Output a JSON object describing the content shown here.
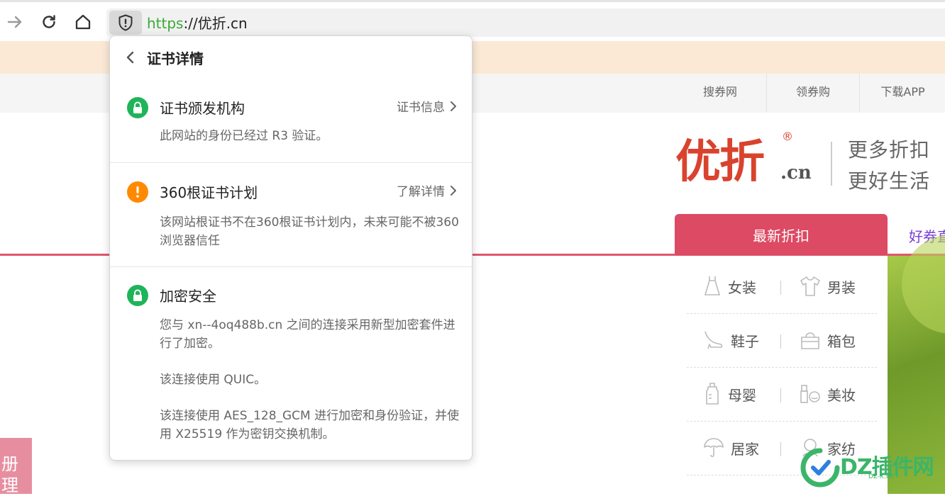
{
  "browser": {
    "url_protocol": "https",
    "url_rest": "://优折.cn",
    "icons": [
      "forward-icon",
      "reload-icon",
      "home-icon",
      "shield-icon"
    ]
  },
  "site": {
    "top_links": [
      "搜券网",
      "领券购",
      "下载APP"
    ],
    "logo_text": "优折",
    "logo_domain": ".cn",
    "logo_reg": "®",
    "slogan_line1": "更多折扣",
    "slogan_line2": "更好生活",
    "tab_active": "最新折扣",
    "tab_next": "好券直",
    "categories": [
      {
        "left": "女装",
        "right": "男装",
        "left_icon": "dress-icon",
        "right_icon": "shirt-icon"
      },
      {
        "left": "鞋子",
        "right": "箱包",
        "left_icon": "heel-shoe-icon",
        "right_icon": "bag-icon"
      },
      {
        "left": "母婴",
        "right": "美妆",
        "left_icon": "baby-bottle-icon",
        "right_icon": "cosmetics-icon"
      },
      {
        "left": "居家",
        "right": "家纺",
        "left_icon": "umbrella-icon",
        "right_icon": "textile-icon"
      }
    ],
    "side_button": "册理",
    "watermark_text": "DZ插件网",
    "watermark_sub": "DZ-X.NET"
  },
  "popup": {
    "title": "证书详情",
    "sections": [
      {
        "title": "证书颁发机构",
        "link": "证书信息",
        "desc": "此网站的身份已经过 R3 验证。",
        "status_color": "#1fb45a"
      },
      {
        "title": "360根证书计划",
        "link": "了解详情",
        "desc": "该网站根证书不在360根证书计划内，未来可能不被360浏览器信任",
        "status_color": "#ff8a00"
      },
      {
        "title": "加密安全",
        "desc1": "您与 xn--4oq488b.cn 之间的连接采用新型加密套件进行了加密。",
        "desc2": "该连接使用 QUIC。",
        "desc3": "该连接使用 AES_128_GCM 进行加密和身份验证，并使用 X25519 作为密钥交换机制。",
        "status_color": "#1fb45a"
      }
    ]
  }
}
